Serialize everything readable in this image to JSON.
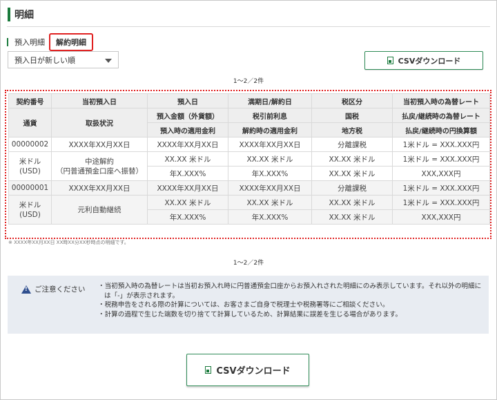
{
  "page": {
    "title": "明細"
  },
  "tabs": [
    {
      "label": "預入明細"
    },
    {
      "label": "解約明細"
    }
  ],
  "sort": {
    "selected": "預入日が新しい順"
  },
  "csv_button": {
    "label": "CSVダウンロード"
  },
  "pager": {
    "text": "1〜2／2件"
  },
  "table": {
    "headers": {
      "row1": [
        "契約番号",
        "当初預入日",
        "預入日",
        "満期日/解約日",
        "税区分",
        "当初預入時の為替レート"
      ],
      "row2": [
        "預入金額（外貨額）",
        "税引前利息",
        "国税",
        "払戻/継続時の為替レート"
      ],
      "row3": [
        "預入時の適用金利",
        "解約時の適用金利",
        "地方税",
        "払戻/継続時の円換算額"
      ],
      "col1_lower": "通貨",
      "col2_lower": "取扱状況"
    },
    "rows": [
      {
        "contract_no": "00000002",
        "initial_date": "XXXX年XX月XX日",
        "currency": "米ドル\n(USD)",
        "status": "中途解約\n（円普通預金口座へ振替）",
        "deposit_date": "XXXX年XX月XX日",
        "amount": "XX.XX 米ドル",
        "deposit_rate": "年X.XXX%",
        "maturity_date": "XXXX年XX月XX日",
        "pre_tax_interest": "XX.XX 米ドル",
        "cancel_rate": "年X.XXX%",
        "tax_class": "分離課税",
        "national_tax": "XX.XX 米ドル",
        "local_tax": "XX.XX 米ドル",
        "fx_initial": "1米ドル = XXX.XXX円",
        "fx_refund": "1米ドル = XXX.XXX円",
        "yen_amount": "XXX,XXX円"
      },
      {
        "contract_no": "00000001",
        "initial_date": "XXXX年XX月XX日",
        "currency": "米ドル\n(USD)",
        "status": "元利自動継続",
        "deposit_date": "XXXX年XX月XX日",
        "amount": "XX.XX 米ドル",
        "deposit_rate": "年X.XXX%",
        "maturity_date": "XXXX年XX月XX日",
        "pre_tax_interest": "XX.XX 米ドル",
        "cancel_rate": "年X.XXX%",
        "tax_class": "分離課税",
        "national_tax": "XX.XX 米ドル",
        "local_tax": "XX.XX 米ドル",
        "fx_initial": "1米ドル = XXX.XXX円",
        "fx_refund": "1米ドル = XXX.XXX円",
        "yen_amount": "XXX,XXX円"
      }
    ]
  },
  "footnote": "※ XXXX年XX月XX日 XX時XX分XX秒時点の明細です。",
  "notice": {
    "heading": "ご注意ください",
    "items": [
      "当初預入時の為替レートは当初お預入れ時に円普通預金口座からお預入れされた明細にのみ表示しています。それ以外の明細には「-」が表示されます。",
      "税務申告をされる際の計算については、お客さまご自身で税理士や税務署等にご相談ください。",
      "計算の過程で生じた端数を切り捨てて計算しているため、計算結果に誤差を生じる場合があります。"
    ]
  },
  "colors": {
    "accent_green": "#1a7a3c",
    "highlight_red": "#e02020",
    "notice_bg": "#e8ecf2"
  }
}
